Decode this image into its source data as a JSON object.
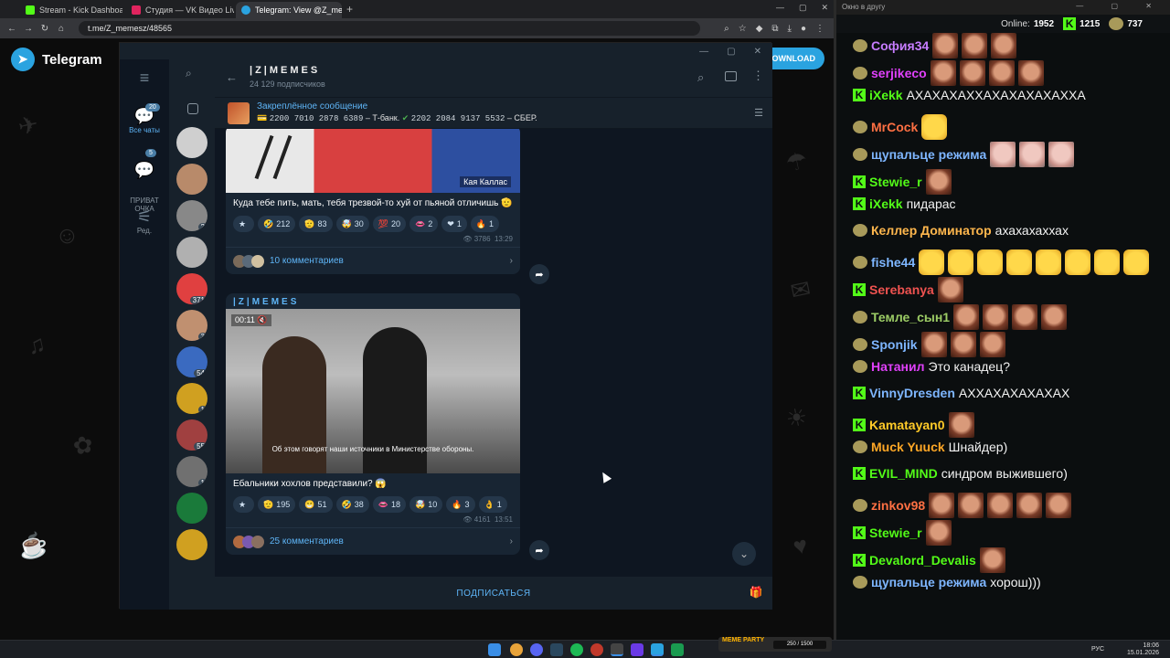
{
  "browser": {
    "tabs": [
      {
        "label": "Stream - Kick Dashboard",
        "color": "#53fc18",
        "active": false
      },
      {
        "label": "Студия — VK Видео Live",
        "color": "#e0245e",
        "active": false
      },
      {
        "label": "Telegram: View @Z_memesz",
        "color": "#2aa3e0",
        "active": true
      }
    ],
    "url": "t.me/Z_memesz/48565",
    "window_controls": [
      "—",
      "▢",
      "✕"
    ]
  },
  "telegram_web": {
    "brand": "Telegram",
    "download_label": "DOWNLOAD"
  },
  "tg_app": {
    "rail": [
      {
        "label": "Все чаты",
        "badge": "20",
        "active": true
      },
      {
        "label": "ПРИВАТ\nОЧКА",
        "badge": "5",
        "active": false
      },
      {
        "label": "Ред.",
        "badge": "",
        "active": false
      }
    ],
    "chat_counts": [
      "",
      "",
      "2",
      "",
      "371",
      "3",
      "54",
      "1",
      "55",
      "1",
      "",
      ""
    ],
    "channel": {
      "name": "|Z|MEMES",
      "subscribers": "24 129 подписчиков"
    },
    "pinned": {
      "title": "Закреплённое сообщение",
      "card1": "2200 7010 2878 6389",
      "bank1": " – Т-банк. ",
      "card2": "2202 2084 9137 5532",
      "bank2": " – СБЕР."
    },
    "posts": [
      {
        "image_caption": "Кая Каллас",
        "text": "Куда тебе пить, мать, тебя трезвой-то хуй от пьяной отличишь",
        "reactions": [
          {
            "emoji": "★",
            "count": ""
          },
          {
            "emoji": "🤣",
            "count": "212"
          },
          {
            "emoji": "🫡",
            "count": "83"
          },
          {
            "emoji": "🤯",
            "count": "30"
          },
          {
            "emoji": "💯",
            "count": "20"
          },
          {
            "emoji": "👄",
            "count": "2"
          },
          {
            "emoji": "❤",
            "count": "1"
          },
          {
            "emoji": "🔥",
            "count": "1"
          }
        ],
        "views": "3786",
        "time": "13:29",
        "comments": "10 комментариев"
      },
      {
        "author": "|Z|MEMES",
        "video_time": "00:11",
        "subtitle": "Об этом говорят наши источники в Министерстве обороны.",
        "text": "Ебальники хохлов представили?",
        "reactions": [
          {
            "emoji": "★",
            "count": ""
          },
          {
            "emoji": "🫡",
            "count": "195"
          },
          {
            "emoji": "😁",
            "count": "51"
          },
          {
            "emoji": "🤣",
            "count": "38"
          },
          {
            "emoji": "👄",
            "count": "18"
          },
          {
            "emoji": "🤯",
            "count": "10"
          },
          {
            "emoji": "🔥",
            "count": "3"
          },
          {
            "emoji": "👌",
            "count": "1"
          }
        ],
        "views": "4161",
        "time": "13:51",
        "comments": "25 комментариев"
      }
    ],
    "subscribe_label": "ПОДПИСАТЬСЯ"
  },
  "kick_chat": {
    "window_title": "Окно в другу",
    "online_label": "Online:",
    "online_count": "1952",
    "kick_count": "1215",
    "coins_count": "737",
    "messages": [
      {
        "user": "София34",
        "color": "#c77dff",
        "badge": "bot",
        "text": "",
        "emotes": [
          "face",
          "face",
          "face"
        ]
      },
      {
        "user": "serjikeco",
        "color": "#e040fb",
        "badge": "bot",
        "text": "",
        "emotes": [
          "face",
          "face",
          "face",
          "face"
        ]
      },
      {
        "user": "iXekk",
        "color": "#53fc18",
        "badge": "kick",
        "text": "АХАХАХАХХАХАХАХАХАХХА",
        "emotes": []
      },
      {
        "user": "MrCock",
        "color": "#ff7043",
        "badge": "bot",
        "text": "",
        "emotes": [
          "yel"
        ]
      },
      {
        "user": "щупальце режима",
        "color": "#7eb6ff",
        "badge": "bot",
        "text": "",
        "emotes": [
          "pink",
          "pink",
          "pink"
        ]
      },
      {
        "user": "Stewie_r",
        "color": "#53fc18",
        "badge": "kick",
        "text": "",
        "emotes": [
          "face"
        ]
      },
      {
        "user": "iXekk",
        "color": "#53fc18",
        "badge": "kick",
        "text": "пидарас",
        "emotes": []
      },
      {
        "user": "Келлер Доминатор",
        "color": "#ffb74d",
        "badge": "bot",
        "text": "ахахахаххах",
        "emotes": []
      },
      {
        "user": "fishe44",
        "color": "#7eb6ff",
        "badge": "bot",
        "text": "",
        "emotes": [
          "yel",
          "yel",
          "yel",
          "yel",
          "yel",
          "yel",
          "yel",
          "yel"
        ]
      },
      {
        "user": "Serebanya",
        "color": "#ef5350",
        "badge": "kick",
        "text": "",
        "emotes": [
          "face"
        ]
      },
      {
        "user": "Темле_сын1",
        "color": "#9ccc65",
        "badge": "bot",
        "text": "",
        "emotes": [
          "face",
          "face",
          "face",
          "face"
        ]
      },
      {
        "user": "Sponjik",
        "color": "#7eb6ff",
        "badge": "bot",
        "text": "",
        "emotes": [
          "face",
          "face",
          "face"
        ]
      },
      {
        "user": "Натанил",
        "color": "#e040fb",
        "badge": "bot",
        "text": "Это канадец?",
        "emotes": []
      },
      {
        "user": "VinnyDresden",
        "color": "#7eb6ff",
        "badge": "kick",
        "text": "АХХАХАХАХАХАХ",
        "emotes": []
      },
      {
        "user": "Kamatayan0",
        "color": "#ffca28",
        "badge": "kick",
        "text": "",
        "emotes": [
          "face"
        ]
      },
      {
        "user": "Muck Yuuck",
        "color": "#ffa726",
        "badge": "bot",
        "text": "Шнайдер)",
        "emotes": []
      },
      {
        "user": "EVIL_MIND",
        "color": "#53fc18",
        "badge": "kick",
        "text": "синдром выжившего)",
        "emotes": []
      },
      {
        "user": "zinkov98",
        "color": "#ff7043",
        "badge": "bot",
        "text": "",
        "emotes": [
          "face",
          "face",
          "face",
          "face",
          "face"
        ]
      },
      {
        "user": "Stewie_r",
        "color": "#53fc18",
        "badge": "kick",
        "text": "",
        "emotes": [
          "face"
        ]
      },
      {
        "user": "Devalord_Devalis",
        "color": "#53fc18",
        "badge": "kick",
        "text": "",
        "emotes": [
          "face"
        ]
      },
      {
        "user": "щупальце режима",
        "color": "#7eb6ff",
        "badge": "bot",
        "text": "хорош)))",
        "emotes": []
      }
    ]
  },
  "taskbar": {
    "lang": "РУС",
    "time": "18:06",
    "date": "15.01.2026",
    "meme_party": "MEME PARTY",
    "meme_progress": "250 / 1500"
  }
}
